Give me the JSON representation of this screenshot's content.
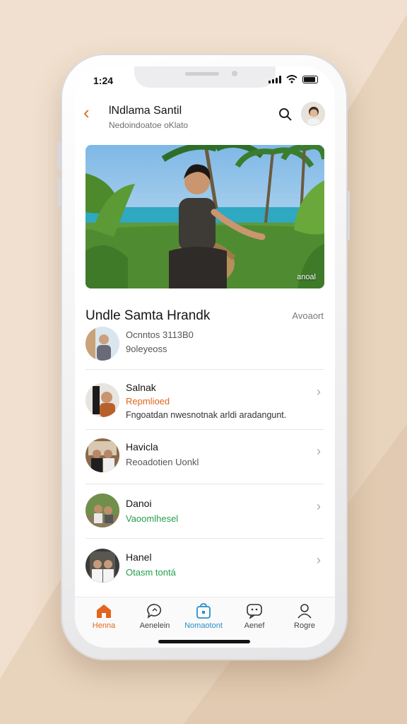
{
  "status_bar": {
    "time": "1:24"
  },
  "header": {
    "title": "lNdlama Santil",
    "subtitle": "Nedoindoatoe oKlato"
  },
  "hero": {
    "badge": "anoal"
  },
  "section": {
    "title": "Undle Samta Hrandk",
    "right_label": "Avoaort"
  },
  "list": [
    {
      "name": "Ocnntos 3113B0",
      "sub": "9oleyeoss",
      "desc": ""
    },
    {
      "name": "Salnak",
      "sub": "Repmlioed",
      "desc": "Fngoatdan nwesnotnak arldi aradangunt."
    },
    {
      "name": "Havicla",
      "sub": "Reoadotien Uonkl",
      "desc": ""
    },
    {
      "name": "Danoi",
      "sub": "Vaoomlhesel",
      "desc": ""
    },
    {
      "name": "Hanel",
      "sub": "Otasm tontá",
      "desc": ""
    }
  ],
  "tabs": [
    {
      "label": "Henna",
      "icon": "home-icon"
    },
    {
      "label": "Aenelein",
      "icon": "chat-icon"
    },
    {
      "label": "Nomaotont",
      "icon": "bag-icon"
    },
    {
      "label": "Aenef",
      "icon": "message-icon"
    },
    {
      "label": "Rogre",
      "icon": "person-icon"
    }
  ],
  "colors": {
    "accent": "#e2661f",
    "orange_sub": "#e2661f",
    "green_sub": "#23a04b",
    "active_tab": "#2a8fc9",
    "muted": "#6f6f6f"
  }
}
